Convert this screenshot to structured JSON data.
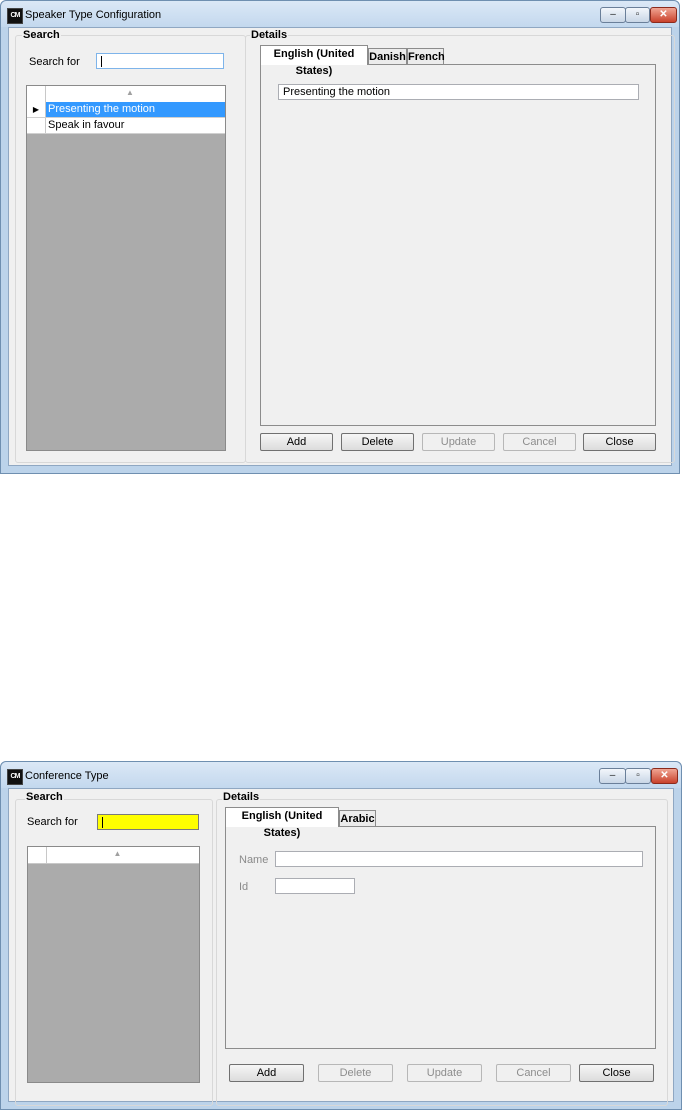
{
  "window1": {
    "title": "Speaker Type Configuration",
    "app_icon_text": "CM",
    "search_group": "Search",
    "search_label": "Search for",
    "search_value": "",
    "rows": [
      "Presenting the motion",
      "Speak in favour"
    ],
    "details_group": "Details",
    "tabs": [
      "English (United States)",
      "Danish",
      "French"
    ],
    "name_value": "Presenting the motion",
    "buttons": [
      "Add",
      "Delete",
      "Update",
      "Cancel",
      "Close"
    ]
  },
  "window2": {
    "title": "Conference Type",
    "app_icon_text": "CM",
    "search_group": "Search",
    "search_label": "Search for",
    "search_value": "",
    "details_group": "Details",
    "tabs": [
      "English (United States)",
      "Arabic"
    ],
    "name_label": "Name",
    "id_label": "Id",
    "name_value": "",
    "id_value": "",
    "buttons": [
      "Add",
      "Delete",
      "Update",
      "Cancel",
      "Close"
    ]
  },
  "window_controls": {
    "minimize_glyph": "–",
    "restore_glyph": "▫",
    "close_glyph": "✕"
  },
  "colors": {
    "selection": "#3399ff",
    "search_highlight": "#ffff00",
    "grid_background": "#ababab"
  }
}
